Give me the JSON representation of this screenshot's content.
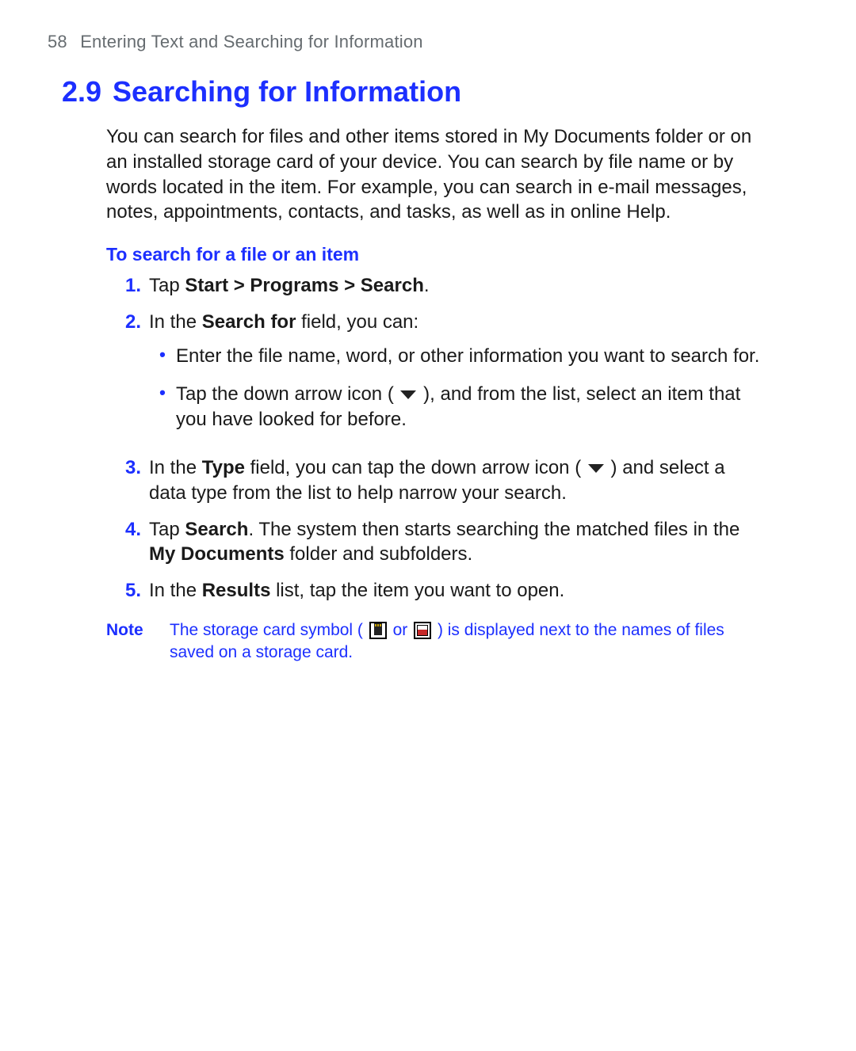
{
  "header": {
    "page_number": "58",
    "chapter_title": "Entering Text and Searching for Information"
  },
  "section": {
    "number": "2.9",
    "title": "Searching for Information"
  },
  "intro": "You can search for files and other items stored in My Documents folder or on an installed storage card of your device. You can search by file name or by words located in the item. For example, you can search in e-mail messages, notes, appointments, contacts, and tasks, as well as in online Help.",
  "procedure_heading": "To search for a file or an item",
  "steps": {
    "s1": {
      "num": "1.",
      "pre": "Tap ",
      "bold": "Start > Programs > Search",
      "post": "."
    },
    "s2": {
      "num": "2.",
      "pre": "In the ",
      "bold": "Search for",
      "post": " field, you can:"
    },
    "s2_bullets": {
      "b1": "Enter the file name, word, or other information you want to search for.",
      "b2_pre": "Tap the down arrow icon ( ",
      "b2_post": " ), and from the list, select an item that you have looked for before."
    },
    "s3": {
      "num": "3.",
      "pre": "In the ",
      "bold": "Type",
      "mid": " field, you can tap the down arrow icon ( ",
      "post": " ) and select a data type from the list to help narrow your search."
    },
    "s4": {
      "num": "4.",
      "pre": "Tap ",
      "bold1": "Search",
      "mid": ". The system then starts searching the matched files in the ",
      "bold2": "My Documents",
      "post": " folder and subfolders."
    },
    "s5": {
      "num": "5.",
      "pre": "In the ",
      "bold": "Results",
      "post": " list, tap the item you want to open."
    }
  },
  "note": {
    "label": "Note",
    "pre": "The storage card symbol ( ",
    "mid": " or ",
    "post": " ) is displayed next to the names of files saved on a storage card."
  }
}
